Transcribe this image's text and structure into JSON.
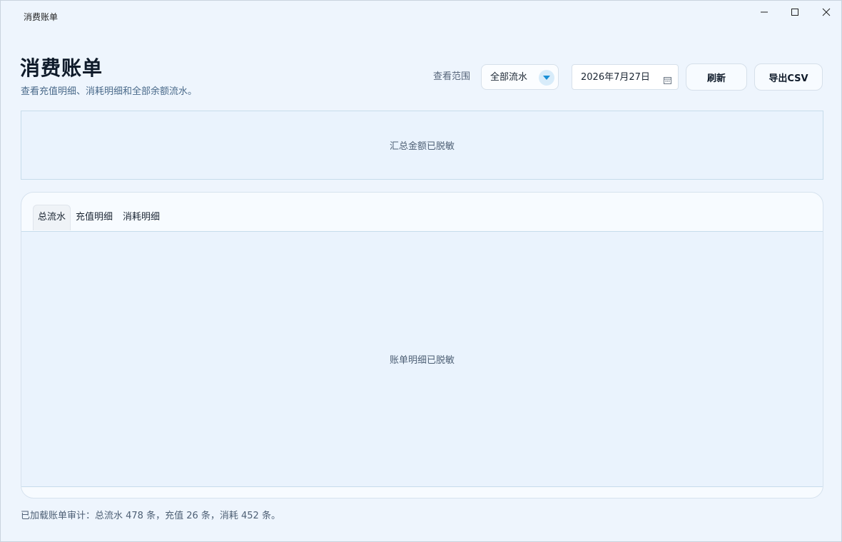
{
  "window": {
    "title": "消费账单"
  },
  "header": {
    "title": "消费账单",
    "subtitle": "查看充值明细、消耗明细和全部余额流水。"
  },
  "toolbar": {
    "range_label": "查看范围",
    "range_value": "全部流水",
    "date_value": "2026年7月27日",
    "refresh_label": "刷新",
    "export_label": "导出CSV"
  },
  "summary": {
    "text": "汇总金额已脱敏"
  },
  "tabs": [
    {
      "label": "总流水",
      "active": true
    },
    {
      "label": "充值明细",
      "active": false
    },
    {
      "label": "消耗明细",
      "active": false
    }
  ],
  "detail": {
    "text": "账单明细已脱敏"
  },
  "footer": {
    "status": "已加载账单审计：总流水 478 条，充值 26 条，消耗 452 条。"
  },
  "icons": {
    "minimize": "minimize-icon",
    "maximize": "maximize-icon",
    "close": "close-icon",
    "dropdown": "chevron-down-icon",
    "calendar": "calendar-icon"
  },
  "colors": {
    "background": "#eef5fd",
    "accent": "#1a8fd6",
    "title": "#0f1b2a",
    "subtitle": "#4a6a8a"
  }
}
